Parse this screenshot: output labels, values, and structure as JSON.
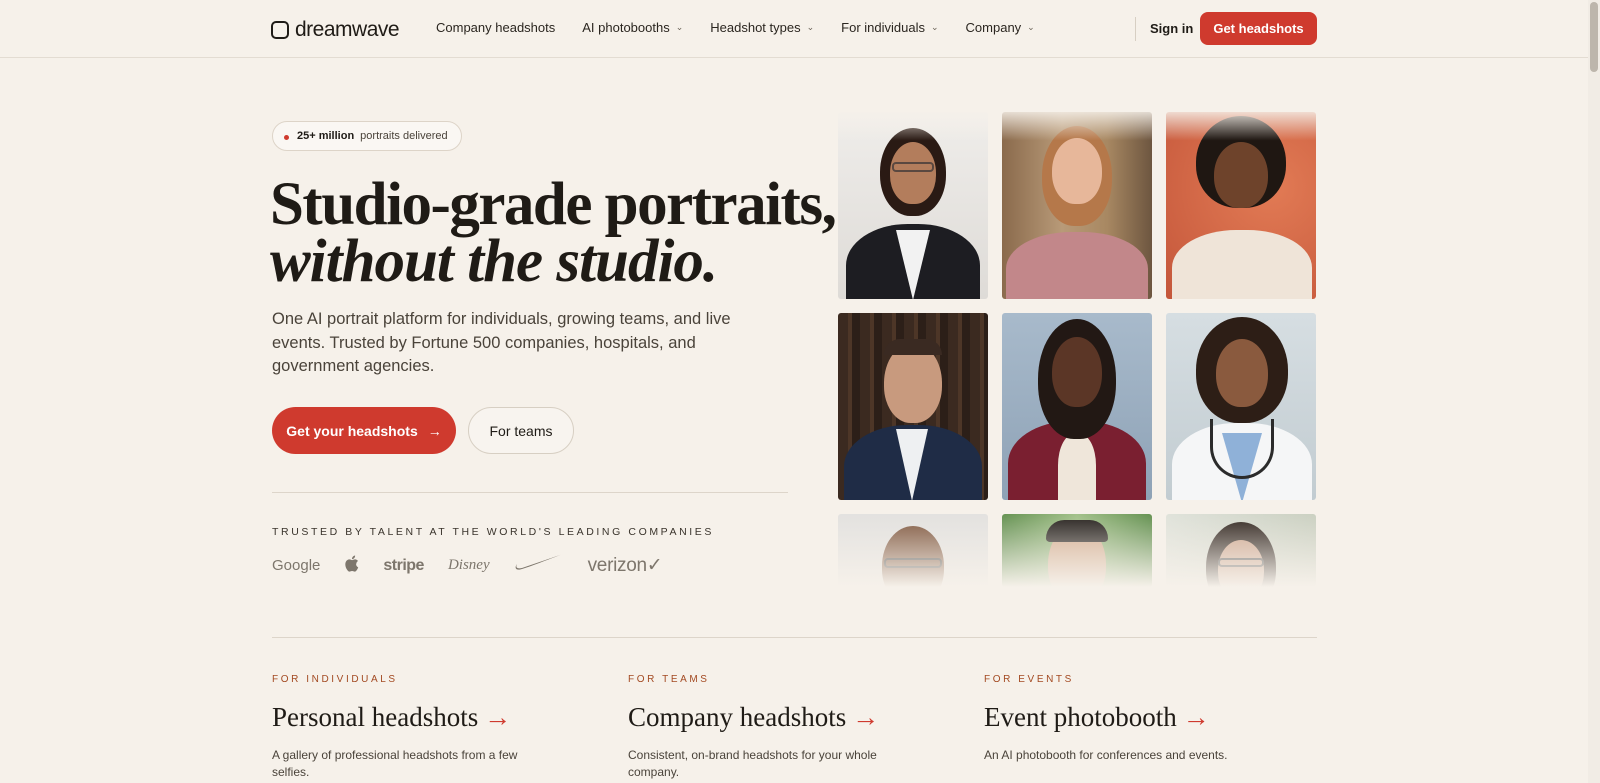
{
  "nav": {
    "brand": "dreamwave",
    "links": [
      {
        "label": "Company headshots",
        "dropdown": false
      },
      {
        "label": "AI photobooths",
        "dropdown": true
      },
      {
        "label": "Headshot types",
        "dropdown": true
      },
      {
        "label": "For individuals",
        "dropdown": true
      },
      {
        "label": "Company",
        "dropdown": true
      }
    ],
    "sign_in": "Sign in",
    "cta": "Get headshots"
  },
  "hero": {
    "badge_strong": "25+ million",
    "badge_text": "portraits delivered",
    "title_line1": "Studio-grade portraits,",
    "title_line2": "without the studio.",
    "lede": "One AI portrait platform for individuals, growing teams, and live events. Trusted by Fortune 500 companies, hospitals, and government agencies.",
    "primary_cta": "Get your headshots",
    "primary_cta_icon": "→",
    "secondary_cta": "For teams",
    "trusted_label": "TRUSTED BY TALENT AT THE WORLD'S LEADING COMPANIES",
    "company_logos": [
      {
        "name": "google",
        "text": "Google"
      },
      {
        "name": "apple",
        "text": ""
      },
      {
        "name": "stripe",
        "text": "stripe"
      },
      {
        "name": "disney",
        "text": "Disney"
      },
      {
        "name": "nike",
        "text": ""
      },
      {
        "name": "verizon",
        "text": "verizon✓"
      }
    ]
  },
  "portraits": [
    {
      "name": "portrait-woman-glasses-black-blazer",
      "bg": "#e8e6e3"
    },
    {
      "name": "portrait-woman-auburn-pink-sweater",
      "bg": "#8a6a4c"
    },
    {
      "name": "portrait-woman-curly-orange-bg",
      "bg": "#d4684a"
    },
    {
      "name": "portrait-man-navy-suit-library",
      "bg": "#3b2a20"
    },
    {
      "name": "portrait-woman-braids-burgundy-blazer",
      "bg": "#9aaec0"
    },
    {
      "name": "portrait-woman-doctor-stethoscope",
      "bg": "#c9d4d8"
    },
    {
      "name": "portrait-man-glasses",
      "bg": "#dcdcdc"
    },
    {
      "name": "portrait-man-green-bg",
      "bg": "#6f9a5a"
    },
    {
      "name": "portrait-woman-glasses-light-bg",
      "bg": "#d7d9d2"
    }
  ],
  "sections": [
    {
      "kicker": "FOR INDIVIDUALS",
      "title": "Personal headshots",
      "arrow": "→",
      "desc": "A gallery of professional headshots from a few selfies."
    },
    {
      "kicker": "FOR TEAMS",
      "title": "Company headshots",
      "arrow": "→",
      "desc": "Consistent, on-brand headshots for your whole company."
    },
    {
      "kicker": "FOR EVENTS",
      "title": "Event photobooth",
      "arrow": "→",
      "desc": "An AI photobooth for conferences and events."
    }
  ],
  "colors": {
    "accent": "#cf3a2e",
    "background": "#f6f1ea",
    "kicker": "#a34a22"
  }
}
